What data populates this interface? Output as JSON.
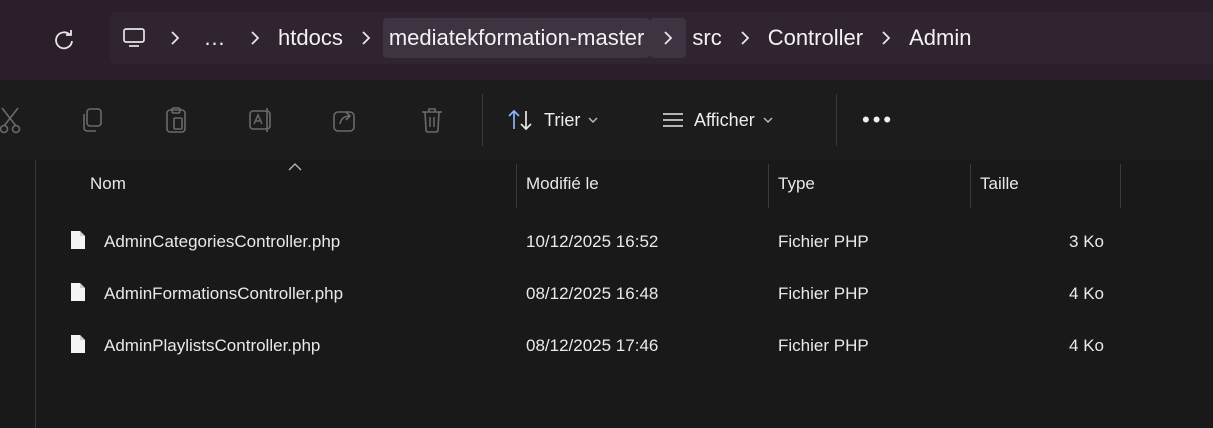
{
  "address_bar": {
    "more_label": "…",
    "crumbs": [
      "htdocs",
      "mediatekformation-master",
      "src",
      "Controller",
      "Admin"
    ]
  },
  "toolbar": {
    "sort_label": "Trier",
    "view_label": "Afficher",
    "more_label": "•••"
  },
  "columns": {
    "name": "Nom",
    "modified": "Modifié le",
    "type": "Type",
    "size": "Taille"
  },
  "files": [
    {
      "name": "AdminCategoriesController.php",
      "modified": "10/12/2025 16:52",
      "type": "Fichier PHP",
      "size": "3 Ko"
    },
    {
      "name": "AdminFormationsController.php",
      "modified": "08/12/2025 16:48",
      "type": "Fichier PHP",
      "size": "4 Ko"
    },
    {
      "name": "AdminPlaylistsController.php",
      "modified": "08/12/2025 17:46",
      "type": "Fichier PHP",
      "size": "4 Ko"
    }
  ],
  "colors": {
    "title_bar": "#2a1f2b",
    "background": "#191919",
    "accent_sort": "#8ab4f8"
  },
  "icons": [
    "refresh-icon",
    "computer-icon",
    "chevron-right-icon",
    "cut-icon",
    "copy-icon",
    "paste-icon",
    "rename-icon",
    "share-icon",
    "delete-icon",
    "sort-icon",
    "view-icon",
    "file-icon"
  ]
}
